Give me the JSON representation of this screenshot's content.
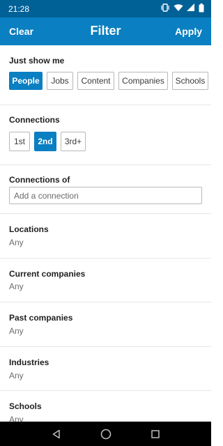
{
  "status_bar": {
    "time": "21:28"
  },
  "header": {
    "clear_label": "Clear",
    "title": "Filter",
    "apply_label": "Apply"
  },
  "just_show_me": {
    "title": "Just show me",
    "options": [
      "People",
      "Jobs",
      "Content",
      "Companies",
      "Schools"
    ],
    "selected": "People"
  },
  "connections": {
    "title": "Connections",
    "options": [
      "1st",
      "2nd",
      "3rd+"
    ],
    "selected": "2nd"
  },
  "connections_of": {
    "title": "Connections of",
    "placeholder": "Add a connection"
  },
  "filters": [
    {
      "title": "Locations",
      "value": "Any"
    },
    {
      "title": "Current companies",
      "value": "Any"
    },
    {
      "title": "Past companies",
      "value": "Any"
    },
    {
      "title": "Industries",
      "value": "Any"
    },
    {
      "title": "Schools",
      "value": "Any"
    }
  ],
  "nav": {
    "icons": [
      "back-icon",
      "home-icon",
      "recents-icon"
    ]
  },
  "colors": {
    "primary": "#0a7fc1",
    "status_bar": "#006197",
    "nav_bar": "#000000"
  }
}
